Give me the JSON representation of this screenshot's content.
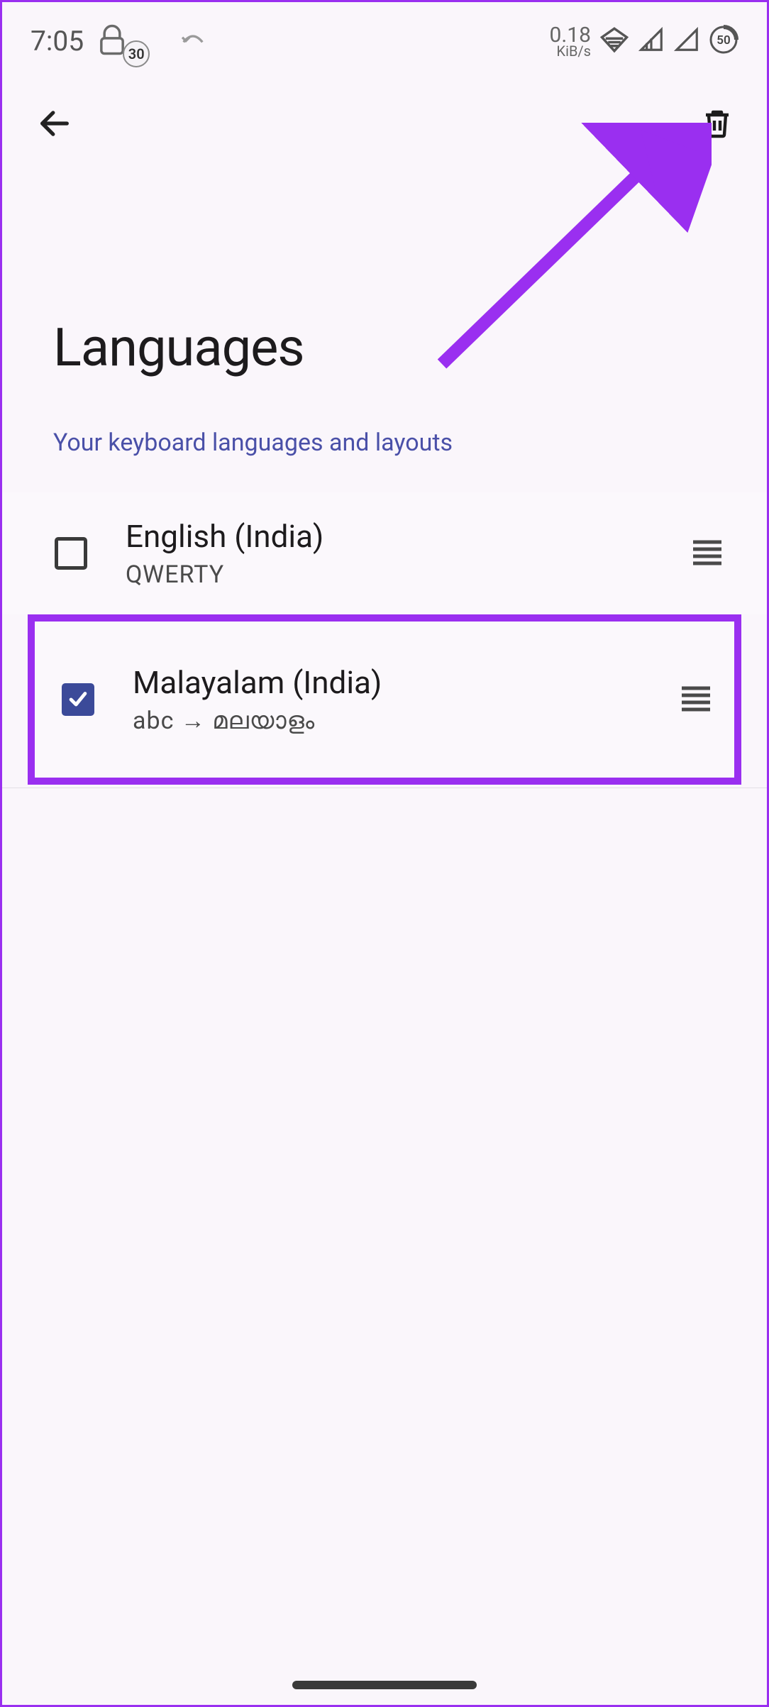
{
  "status": {
    "time": "7:05",
    "notif_badge": "30",
    "net_rate_value": "0.18",
    "net_rate_unit": "KiB/s",
    "battery_pct": "50"
  },
  "page": {
    "title": "Languages",
    "subtitle": "Your keyboard languages and layouts"
  },
  "languages": [
    {
      "name": "English (India)",
      "layout": "QWERTY",
      "checked": false,
      "highlight": false
    },
    {
      "name": "Malayalam (India)",
      "layout": "abc → മലയാളം",
      "checked": true,
      "highlight": true
    }
  ]
}
